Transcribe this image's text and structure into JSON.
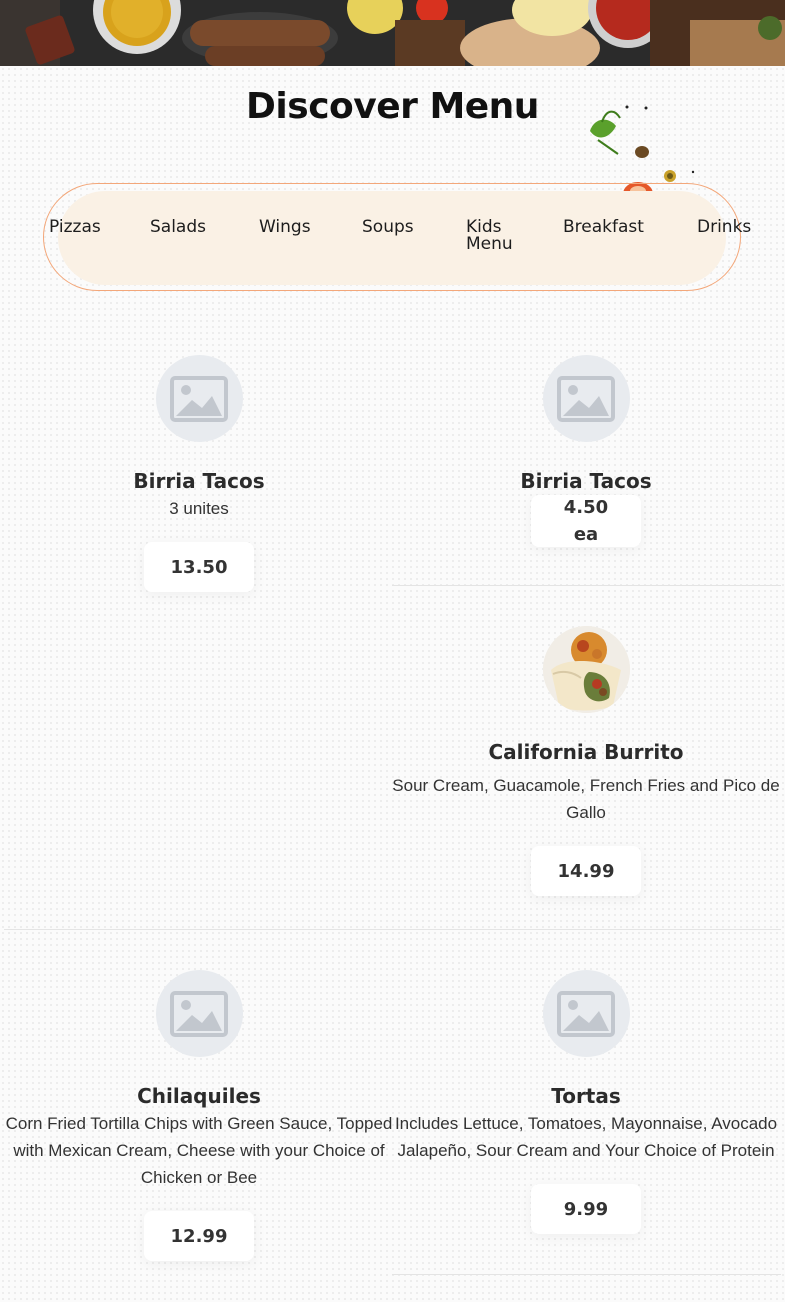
{
  "title": "Discover Menu",
  "nav": {
    "items": [
      "Pizzas",
      "Salads",
      "Wings",
      "Soups",
      "Kids Menu",
      "Breakfast",
      "Drinks"
    ]
  },
  "menu_items": [
    {
      "name": "Birria Tacos",
      "desc": "3 unites",
      "price": "13.50",
      "image": "placeholder-icon"
    },
    {
      "name": "Birria Tacos",
      "desc": "",
      "price": "4.50 ea",
      "image": "placeholder-icon"
    },
    {
      "name": "California Burrito",
      "desc": "Sour Cream, Guacamole, French Fries and Pico de Gallo",
      "price": "14.99",
      "image": "burrito-photo"
    },
    {
      "name": "Chilaquiles",
      "desc": "Corn Fried Tortilla Chips with Green Sauce, Topped with Mexican Cream, Cheese with your Choice of Chicken or Bee",
      "price": "12.99",
      "image": "placeholder-icon"
    },
    {
      "name": "Tortas",
      "desc": "Includes Lettuce, Tomatoes, Mayonnaise, Avocado Jalapeño, Sour Cream and Your Choice of Protein",
      "price": "9.99",
      "image": "placeholder-icon"
    }
  ],
  "colors": {
    "accent_border": "#f3a77a",
    "nav_bg": "#faf1e5",
    "placeholder_bg": "#e8ebef"
  }
}
